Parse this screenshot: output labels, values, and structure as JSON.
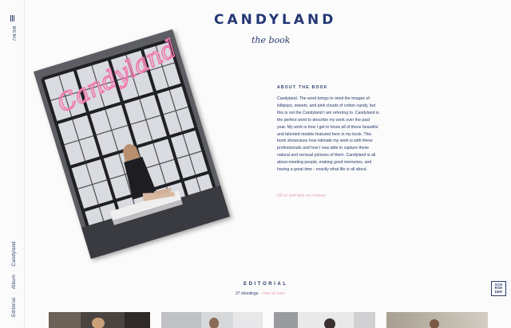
{
  "rail": {
    "menu_label": "MENU",
    "breadcrumb": [
      "Editorial",
      "Album",
      "Candyland"
    ]
  },
  "header": {
    "title": "CANDYLAND",
    "subtitle": "the book"
  },
  "book": {
    "cover_script": "Candyland"
  },
  "about": {
    "heading": "ABOUT THE BOOK",
    "text": "Candyland. The word brings to mind the images of lollipops, sweets, and pink clouds of cotton candy, but this is not the Candyland I am referring to. Candyland is the perfect word to describe my work over the past year. My work is how I get to know all of these beautiful and talented models featured here in my book. This book showcases how intimate my work is with these professionals and how I was able to capture these natural and sensual pictures of them. Candyland is all about meeting people, making good memories, and having a great time - exactly what life is all about.",
    "link": "Hit us and take my money!"
  },
  "editorial": {
    "title": "EDITORIAL",
    "count": "27 shootings",
    "view_all": "view all here"
  },
  "logo": {
    "lines": [
      "SCH",
      "ROE",
      "DER"
    ]
  },
  "thumbnails": [
    {
      "label": "shooting-1"
    },
    {
      "label": "shooting-2"
    },
    {
      "label": "shooting-3"
    },
    {
      "label": "shooting-4"
    }
  ],
  "colors": {
    "navy": "#243774",
    "pink_link": "#e6a6b6",
    "cover_script": "#f07ab0",
    "background": "#fbfbfb"
  }
}
